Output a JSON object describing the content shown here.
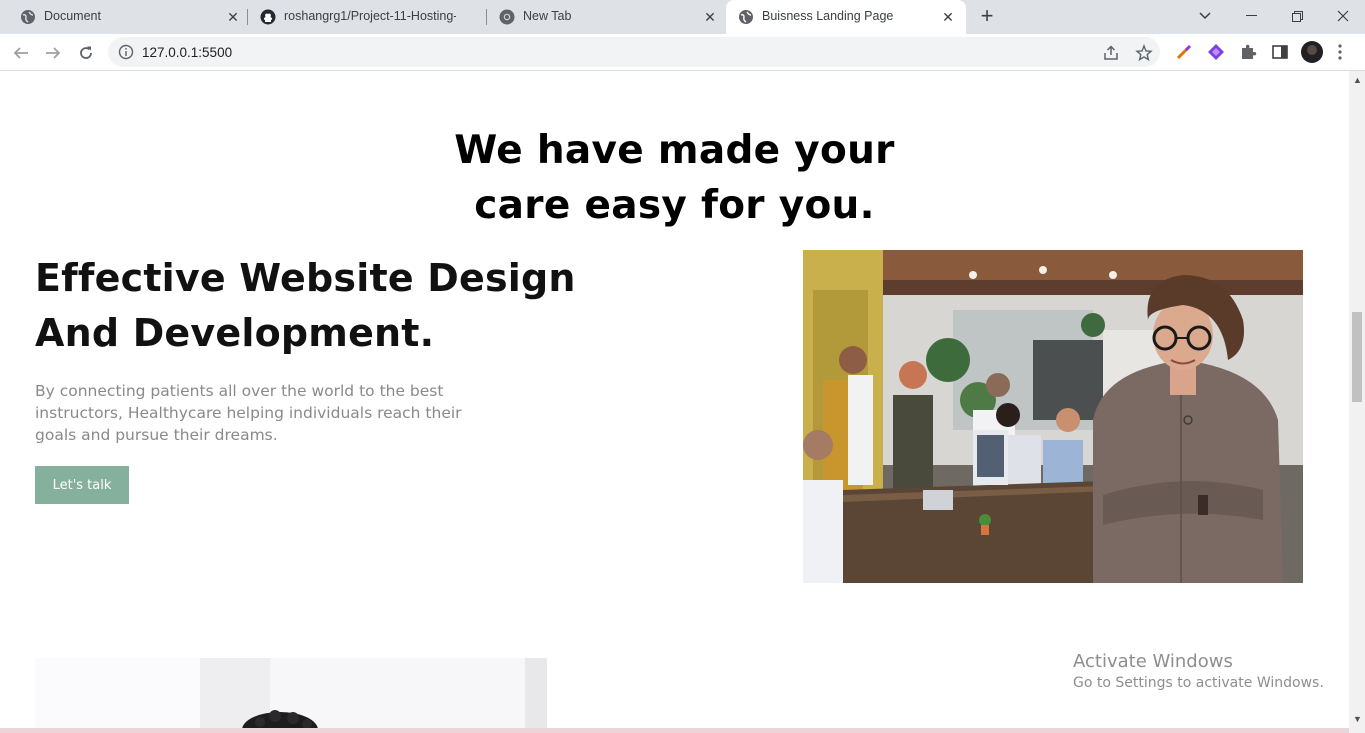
{
  "tabs": [
    {
      "title": "Document",
      "active": false,
      "icon": "globe-icon"
    },
    {
      "title": "roshangrg1/Project-11-Hosting-",
      "active": false,
      "icon": "github-icon"
    },
    {
      "title": "New Tab",
      "active": false,
      "icon": "chrome-icon"
    },
    {
      "title": "Buisness Landing Page",
      "active": true,
      "icon": "globe-icon"
    }
  ],
  "address_bar": {
    "url": "127.0.0.1:5500"
  },
  "page": {
    "section_heading_line1": "We have made your",
    "section_heading_line2": "care easy for you.",
    "feature_heading_line1": "Effective Website Design",
    "feature_heading_line2": "And Development.",
    "feature_text": "By connecting patients all over the world to the best instructors, Healthycare helping individuals reach their goals and pursue their dreams.",
    "cta_label": "Let's talk"
  },
  "watermark": {
    "title": "Activate Windows",
    "subtitle": "Go to Settings to activate Windows."
  },
  "colors": {
    "cta_background": "#86b09e",
    "tabstrip_background": "#dee1e6"
  }
}
